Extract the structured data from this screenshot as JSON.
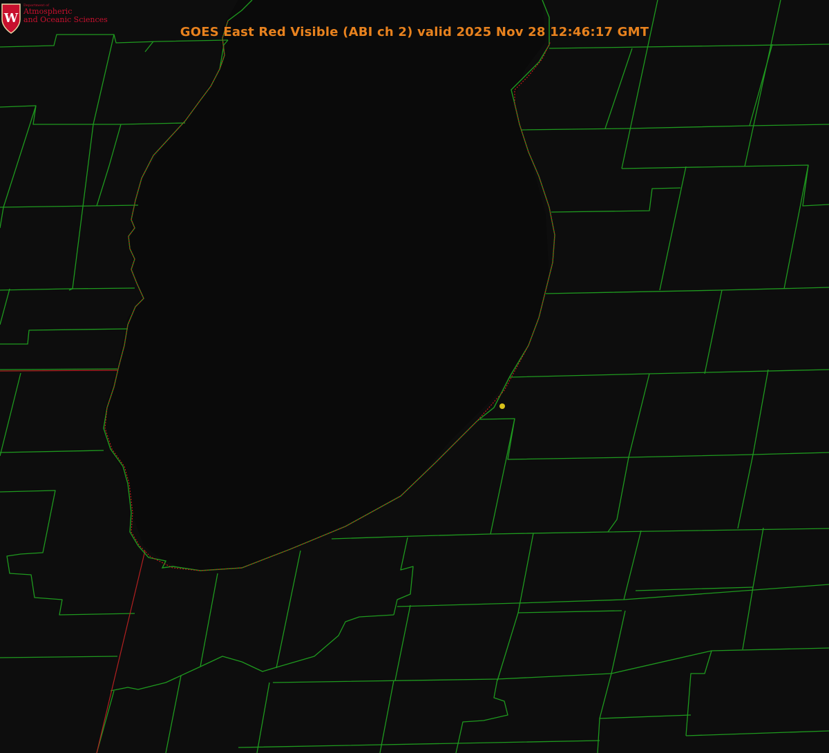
{
  "title": "GOES East Red Visible (ABI ch 2) valid 2025 Nov 28 12:46:17 GMT",
  "logo": {
    "department": "Department of",
    "line1": "Atmospheric",
    "line2": "and Oceanic Sciences",
    "crest_letter": "W"
  },
  "colors": {
    "background": "#0d0d0d",
    "county_lines": "#1f9a1f",
    "shoreline_dots": "#c41a1a",
    "title": "#e8821e",
    "marker": "#d9c21a",
    "logo": "#c8102e"
  },
  "map": {
    "product": "GOES East Red Visible",
    "layers": [
      "county-boundaries",
      "lake-shoreline",
      "state-boundary",
      "location-marker"
    ]
  }
}
